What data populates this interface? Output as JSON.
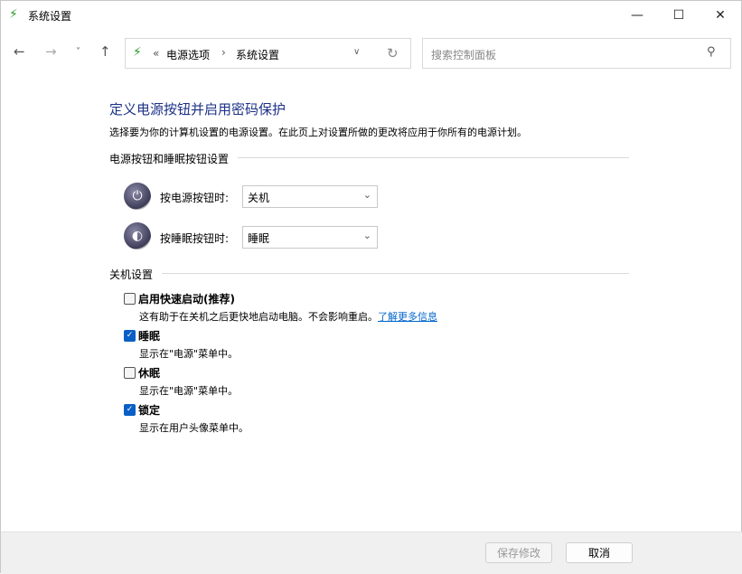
{
  "window": {
    "title": "系统设置"
  },
  "address": {
    "crumbs": [
      "电源选项",
      "系统设置"
    ],
    "sep": "«"
  },
  "search": {
    "placeholder": "搜索控制面板"
  },
  "main": {
    "heading": "定义电源按钮并启用密码保护",
    "description": "选择要为你的计算机设置的电源设置。在此页上对设置所做的更改将应用于你所有的电源计划。",
    "buttons_section": "电源按钮和睡眠按钮设置",
    "power_label": "按电源按钮时:",
    "power_value": "关机",
    "sleep_label": "按睡眠按钮时:",
    "sleep_value": "睡眠",
    "shutdown_section": "关机设置",
    "options": [
      {
        "label": "启用快速启动(推荐)",
        "checked": false,
        "desc": "这有助于在关机之后更快地启动电脑。不会影响重启。",
        "link": "了解更多信息"
      },
      {
        "label": "睡眠",
        "checked": true,
        "desc": "显示在\"电源\"菜单中。"
      },
      {
        "label": "休眠",
        "checked": false,
        "desc": "显示在\"电源\"菜单中。"
      },
      {
        "label": "锁定",
        "checked": true,
        "desc": "显示在用户头像菜单中。"
      }
    ]
  },
  "footer": {
    "save": "保存修改",
    "cancel": "取消"
  },
  "colors": {
    "accent": "#0a5fc6",
    "heading": "#1e3287"
  }
}
